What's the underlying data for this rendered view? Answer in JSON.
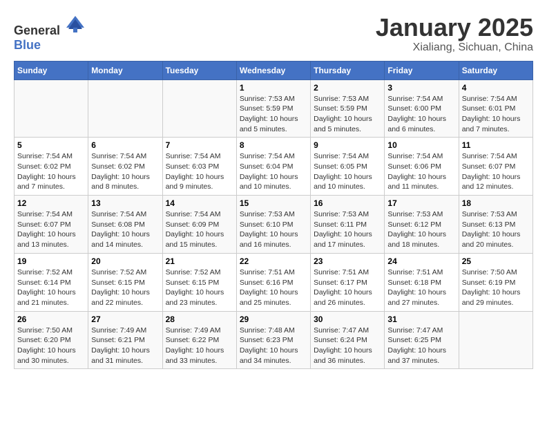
{
  "header": {
    "logo_general": "General",
    "logo_blue": "Blue",
    "title": "January 2025",
    "subtitle": "Xialiang, Sichuan, China"
  },
  "calendar": {
    "days_of_week": [
      "Sunday",
      "Monday",
      "Tuesday",
      "Wednesday",
      "Thursday",
      "Friday",
      "Saturday"
    ],
    "weeks": [
      [
        {
          "day": "",
          "info": ""
        },
        {
          "day": "",
          "info": ""
        },
        {
          "day": "",
          "info": ""
        },
        {
          "day": "1",
          "info": "Sunrise: 7:53 AM\nSunset: 5:59 PM\nDaylight: 10 hours\nand 5 minutes."
        },
        {
          "day": "2",
          "info": "Sunrise: 7:53 AM\nSunset: 5:59 PM\nDaylight: 10 hours\nand 5 minutes."
        },
        {
          "day": "3",
          "info": "Sunrise: 7:54 AM\nSunset: 6:00 PM\nDaylight: 10 hours\nand 6 minutes."
        },
        {
          "day": "4",
          "info": "Sunrise: 7:54 AM\nSunset: 6:01 PM\nDaylight: 10 hours\nand 7 minutes."
        }
      ],
      [
        {
          "day": "5",
          "info": "Sunrise: 7:54 AM\nSunset: 6:02 PM\nDaylight: 10 hours\nand 7 minutes."
        },
        {
          "day": "6",
          "info": "Sunrise: 7:54 AM\nSunset: 6:02 PM\nDaylight: 10 hours\nand 8 minutes."
        },
        {
          "day": "7",
          "info": "Sunrise: 7:54 AM\nSunset: 6:03 PM\nDaylight: 10 hours\nand 9 minutes."
        },
        {
          "day": "8",
          "info": "Sunrise: 7:54 AM\nSunset: 6:04 PM\nDaylight: 10 hours\nand 10 minutes."
        },
        {
          "day": "9",
          "info": "Sunrise: 7:54 AM\nSunset: 6:05 PM\nDaylight: 10 hours\nand 10 minutes."
        },
        {
          "day": "10",
          "info": "Sunrise: 7:54 AM\nSunset: 6:06 PM\nDaylight: 10 hours\nand 11 minutes."
        },
        {
          "day": "11",
          "info": "Sunrise: 7:54 AM\nSunset: 6:07 PM\nDaylight: 10 hours\nand 12 minutes."
        }
      ],
      [
        {
          "day": "12",
          "info": "Sunrise: 7:54 AM\nSunset: 6:07 PM\nDaylight: 10 hours\nand 13 minutes."
        },
        {
          "day": "13",
          "info": "Sunrise: 7:54 AM\nSunset: 6:08 PM\nDaylight: 10 hours\nand 14 minutes."
        },
        {
          "day": "14",
          "info": "Sunrise: 7:54 AM\nSunset: 6:09 PM\nDaylight: 10 hours\nand 15 minutes."
        },
        {
          "day": "15",
          "info": "Sunrise: 7:53 AM\nSunset: 6:10 PM\nDaylight: 10 hours\nand 16 minutes."
        },
        {
          "day": "16",
          "info": "Sunrise: 7:53 AM\nSunset: 6:11 PM\nDaylight: 10 hours\nand 17 minutes."
        },
        {
          "day": "17",
          "info": "Sunrise: 7:53 AM\nSunset: 6:12 PM\nDaylight: 10 hours\nand 18 minutes."
        },
        {
          "day": "18",
          "info": "Sunrise: 7:53 AM\nSunset: 6:13 PM\nDaylight: 10 hours\nand 20 minutes."
        }
      ],
      [
        {
          "day": "19",
          "info": "Sunrise: 7:52 AM\nSunset: 6:14 PM\nDaylight: 10 hours\nand 21 minutes."
        },
        {
          "day": "20",
          "info": "Sunrise: 7:52 AM\nSunset: 6:15 PM\nDaylight: 10 hours\nand 22 minutes."
        },
        {
          "day": "21",
          "info": "Sunrise: 7:52 AM\nSunset: 6:15 PM\nDaylight: 10 hours\nand 23 minutes."
        },
        {
          "day": "22",
          "info": "Sunrise: 7:51 AM\nSunset: 6:16 PM\nDaylight: 10 hours\nand 25 minutes."
        },
        {
          "day": "23",
          "info": "Sunrise: 7:51 AM\nSunset: 6:17 PM\nDaylight: 10 hours\nand 26 minutes."
        },
        {
          "day": "24",
          "info": "Sunrise: 7:51 AM\nSunset: 6:18 PM\nDaylight: 10 hours\nand 27 minutes."
        },
        {
          "day": "25",
          "info": "Sunrise: 7:50 AM\nSunset: 6:19 PM\nDaylight: 10 hours\nand 29 minutes."
        }
      ],
      [
        {
          "day": "26",
          "info": "Sunrise: 7:50 AM\nSunset: 6:20 PM\nDaylight: 10 hours\nand 30 minutes."
        },
        {
          "day": "27",
          "info": "Sunrise: 7:49 AM\nSunset: 6:21 PM\nDaylight: 10 hours\nand 31 minutes."
        },
        {
          "day": "28",
          "info": "Sunrise: 7:49 AM\nSunset: 6:22 PM\nDaylight: 10 hours\nand 33 minutes."
        },
        {
          "day": "29",
          "info": "Sunrise: 7:48 AM\nSunset: 6:23 PM\nDaylight: 10 hours\nand 34 minutes."
        },
        {
          "day": "30",
          "info": "Sunrise: 7:47 AM\nSunset: 6:24 PM\nDaylight: 10 hours\nand 36 minutes."
        },
        {
          "day": "31",
          "info": "Sunrise: 7:47 AM\nSunset: 6:25 PM\nDaylight: 10 hours\nand 37 minutes."
        },
        {
          "day": "",
          "info": ""
        }
      ]
    ]
  }
}
